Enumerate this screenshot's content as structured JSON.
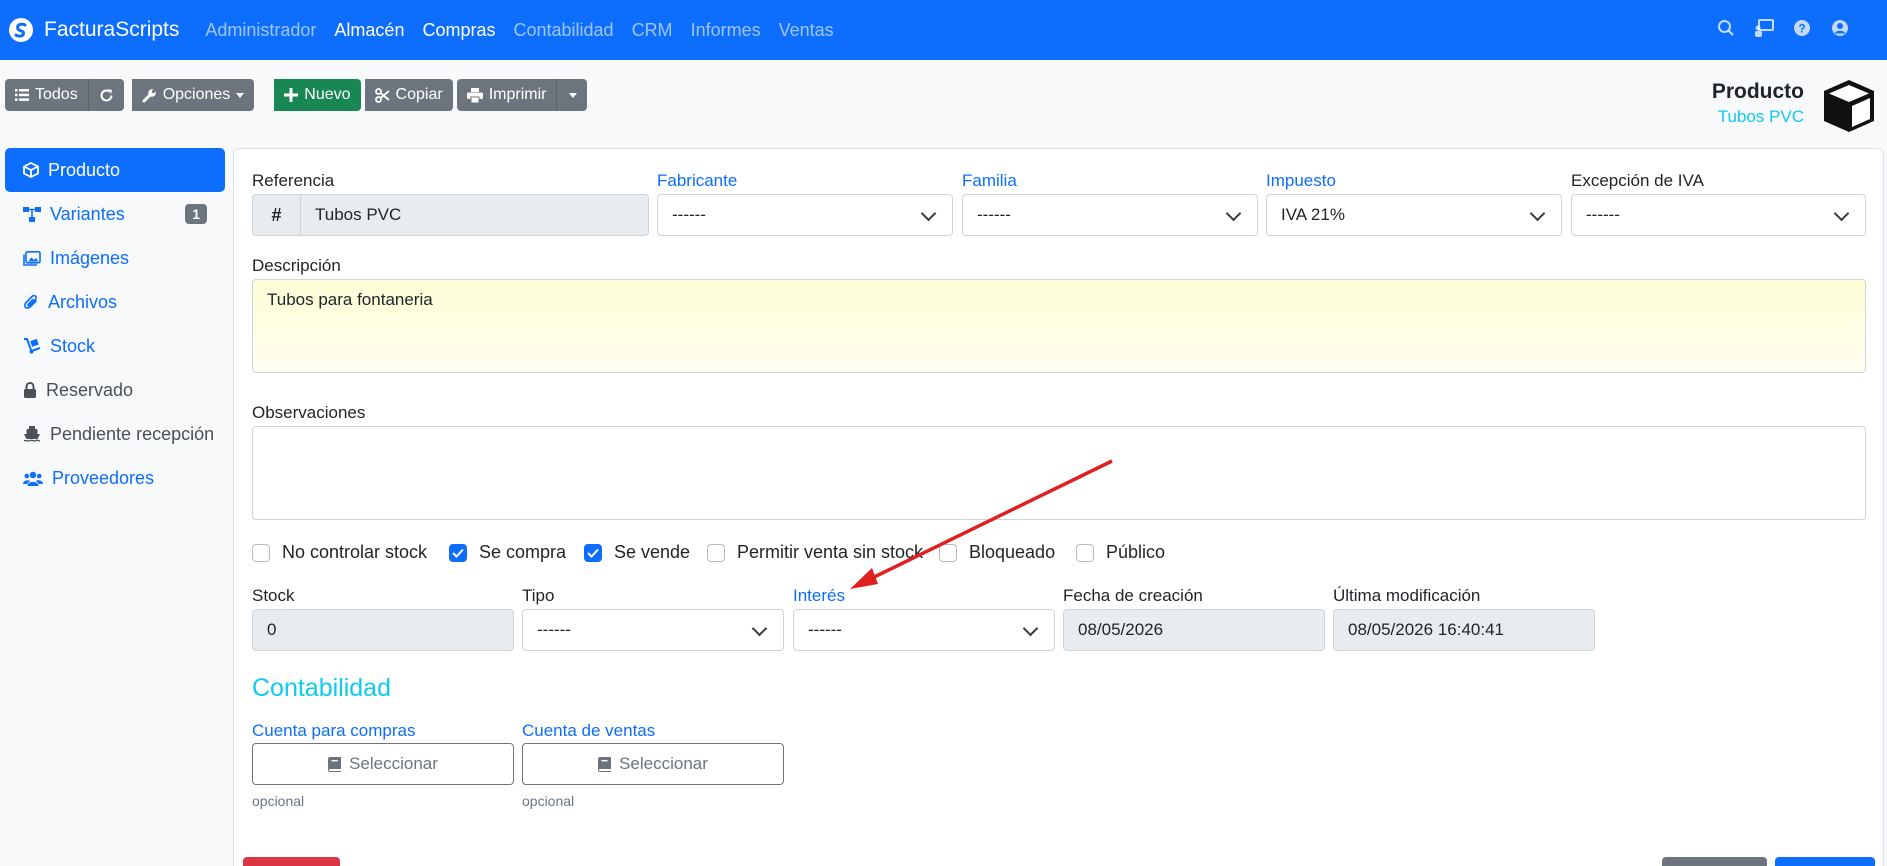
{
  "app": {
    "brand": "FacturaScripts"
  },
  "menu": [
    "Administrador",
    "Almacén",
    "Compras",
    "Contabilidad",
    "CRM",
    "Informes",
    "Ventas"
  ],
  "menu_active": "Almacén",
  "toolbar": {
    "all": "Todos",
    "options": "Opciones",
    "new": "Nuevo",
    "copy": "Copiar",
    "print": "Imprimir"
  },
  "header": {
    "title": "Producto",
    "subtitle": "Tubos PVC"
  },
  "sidebar": {
    "items": [
      {
        "label": "Producto",
        "icon": "cube-icon"
      },
      {
        "label": "Variantes",
        "icon": "sitemap-icon",
        "badge": "1"
      },
      {
        "label": "Imágenes",
        "icon": "images-icon"
      },
      {
        "label": "Archivos",
        "icon": "paperclip-icon"
      },
      {
        "label": "Stock",
        "icon": "dolly-icon"
      },
      {
        "label": "Reservado",
        "icon": "lock-icon"
      },
      {
        "label": "Pendiente recepción",
        "icon": "ship-icon"
      },
      {
        "label": "Proveedores",
        "icon": "users-icon"
      }
    ]
  },
  "form": {
    "reference": {
      "label": "Referencia",
      "prefix": "#",
      "value": "Tubos PVC"
    },
    "manufacturer": {
      "label": "Fabricante",
      "value": "------"
    },
    "family": {
      "label": "Familia",
      "value": "------"
    },
    "tax": {
      "label": "Impuesto",
      "value": "IVA 21%"
    },
    "vat_exception": {
      "label": "Excepción de IVA",
      "value": "------"
    },
    "description": {
      "label": "Descripción",
      "value": "Tubos para fontaneria"
    },
    "notes": {
      "label": "Observaciones",
      "value": ""
    },
    "checks": [
      {
        "label": "No controlar stock",
        "checked": false
      },
      {
        "label": "Se compra",
        "checked": true
      },
      {
        "label": "Se vende",
        "checked": true
      },
      {
        "label": "Permitir venta sin stock",
        "checked": false
      },
      {
        "label": "Bloqueado",
        "checked": false
      },
      {
        "label": "Público",
        "checked": false
      }
    ],
    "stock": {
      "label": "Stock",
      "value": "0"
    },
    "type": {
      "label": "Tipo",
      "value": "------"
    },
    "interest": {
      "label": "Interés",
      "value": "------"
    },
    "created": {
      "label": "Fecha de creación",
      "value": "08/05/2026"
    },
    "modified": {
      "label": "Última modificación",
      "value": "08/05/2026 16:40:41"
    }
  },
  "accounting": {
    "title": "Contabilidad",
    "purchase": {
      "label": "Cuenta para compras",
      "button": "Seleccionar",
      "hint": "opcional"
    },
    "sales": {
      "label": "Cuenta de ventas",
      "button": "Seleccionar",
      "hint": "opcional"
    }
  },
  "colors": {
    "primary": "#0d6efd",
    "info": "#0dcaf0",
    "annotation": "#e02020"
  }
}
